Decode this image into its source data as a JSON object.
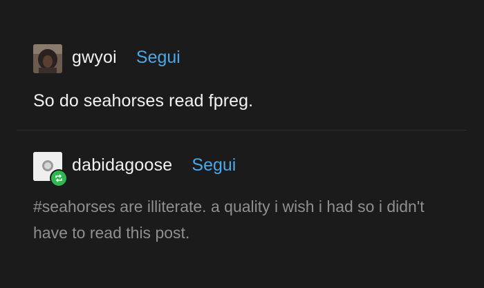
{
  "post1": {
    "username": "gwyoi",
    "follow_label": "Segui",
    "text": "So do seahorses read fpreg."
  },
  "post2": {
    "username": "dabidagoose",
    "follow_label": "Segui",
    "tags_text": "#seahorses are illiterate. a quality i wish i had so i didn't have to read this post."
  },
  "icons": {
    "avatar1": "user-avatar-photo",
    "avatar2": "user-avatar-default",
    "reblog": "reblog-icon"
  },
  "colors": {
    "background": "#1b1b1b",
    "text": "#f2f2f2",
    "follow": "#4aa8e8",
    "tags": "#8f8f8f",
    "reblog_badge": "#2fb84f"
  }
}
